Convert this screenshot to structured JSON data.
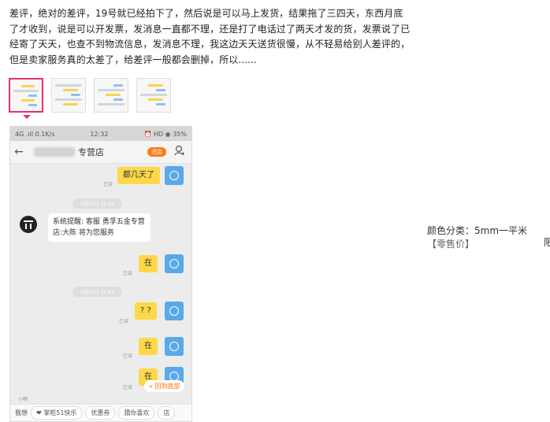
{
  "review": {
    "text": "差评，绝对的差评，19号就已经拍下了，然后说是可以马上发货，结果拖了三四天，东西月底了才收到，说是可以开发票，发消息一直都不理，还是打了电话过了两天才发的货，发票说了已经寄了天天，也查不到物流信息，发消息不理，我这边天天送货很慢，从不轻易给别人差评的，但是卖家服务真的太差了，给差评一般都会删掉，所以......"
  },
  "thumbnails": {
    "count": 4,
    "selected_index": 0
  },
  "phone": {
    "status": {
      "left": "4G .ıll  0.1K/s",
      "time": "12:32",
      "right": "⏰ HD ◉ 35%"
    },
    "nav": {
      "back": "←",
      "shop_suffix": "专营店",
      "enter_label": "进店"
    },
    "messages": {
      "m1": "都几天了",
      "time1": "4月20日 11:09",
      "system": "系统提醒: 客服 勇孚五金专营店:大陈 将为您服务",
      "m2": "在",
      "time2": "4月20日 12:41",
      "m3": "? ?",
      "m4": "在",
      "m5": "在",
      "read": "已读",
      "back_to_bottom": "回到底部",
      "partial_text": "小鲤"
    },
    "input_bar": {
      "label": "我想",
      "chips": [
        "❤ 掌柜51快乐",
        "优惠券",
        "猜你喜欢",
        "店"
      ]
    }
  },
  "sku": {
    "label": "颜色分类：5mm一平米",
    "price": "【零售价】"
  },
  "edge_char": "限"
}
